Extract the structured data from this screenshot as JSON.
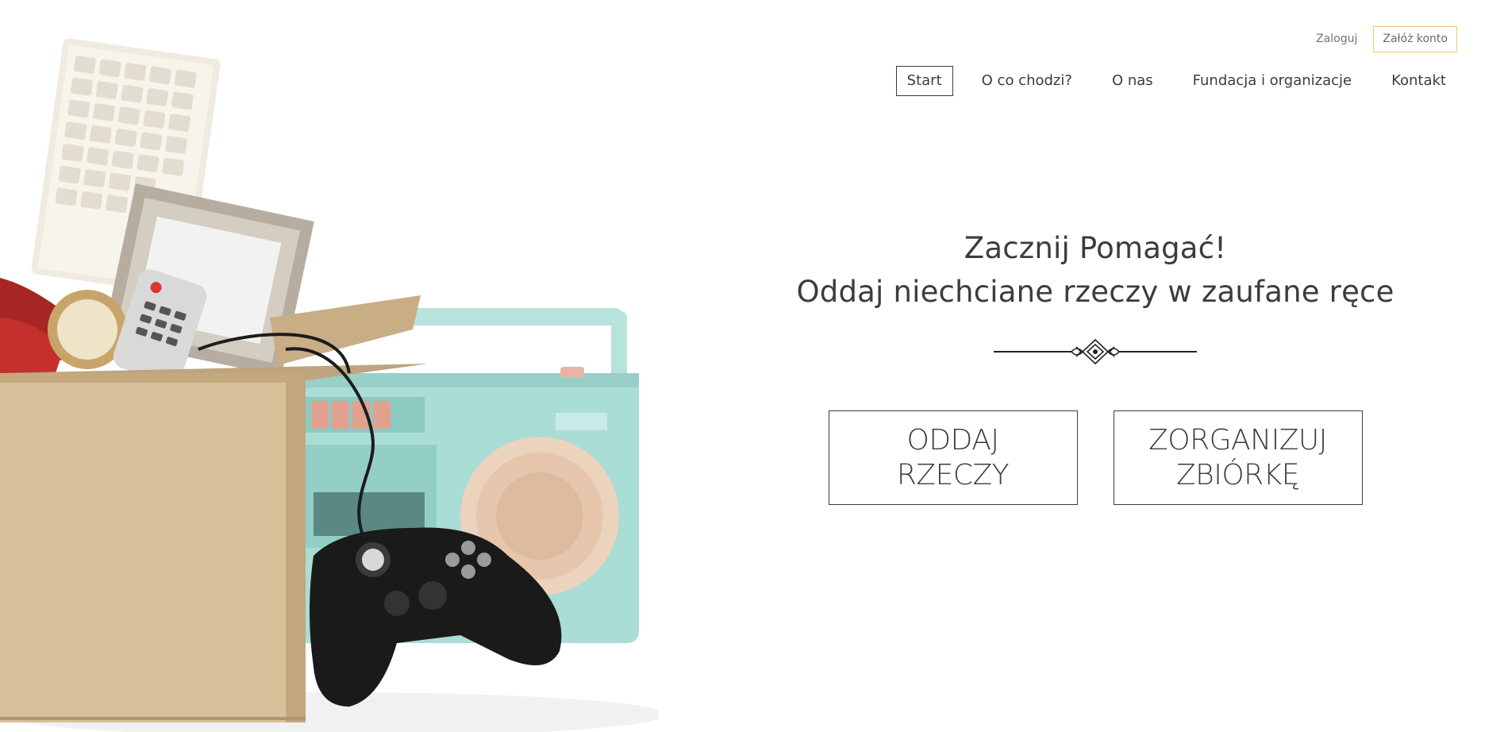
{
  "auth": {
    "login_label": "Zaloguj",
    "register_label": "Załóż konto"
  },
  "nav": {
    "items": [
      {
        "label": "Start",
        "active": true
      },
      {
        "label": "O co chodzi?"
      },
      {
        "label": "O nas"
      },
      {
        "label": "Fundacja i organizacje"
      },
      {
        "label": "Kontakt"
      }
    ]
  },
  "hero": {
    "title_line1": "Zacznij Pomagać!",
    "title_line2": "Oddaj niechciane rzeczy w zaufane ręce",
    "buttons": {
      "give_label": "ODDAJ\nRZECZY",
      "organize_label": "ZORGANIZUJ\nZBIÓRKĘ"
    }
  },
  "colors": {
    "text": "#3c3c3c",
    "register_border": "#f0c96b",
    "box_cardboard": "#d8c09a",
    "radio_mint": "#a9ddd6"
  }
}
